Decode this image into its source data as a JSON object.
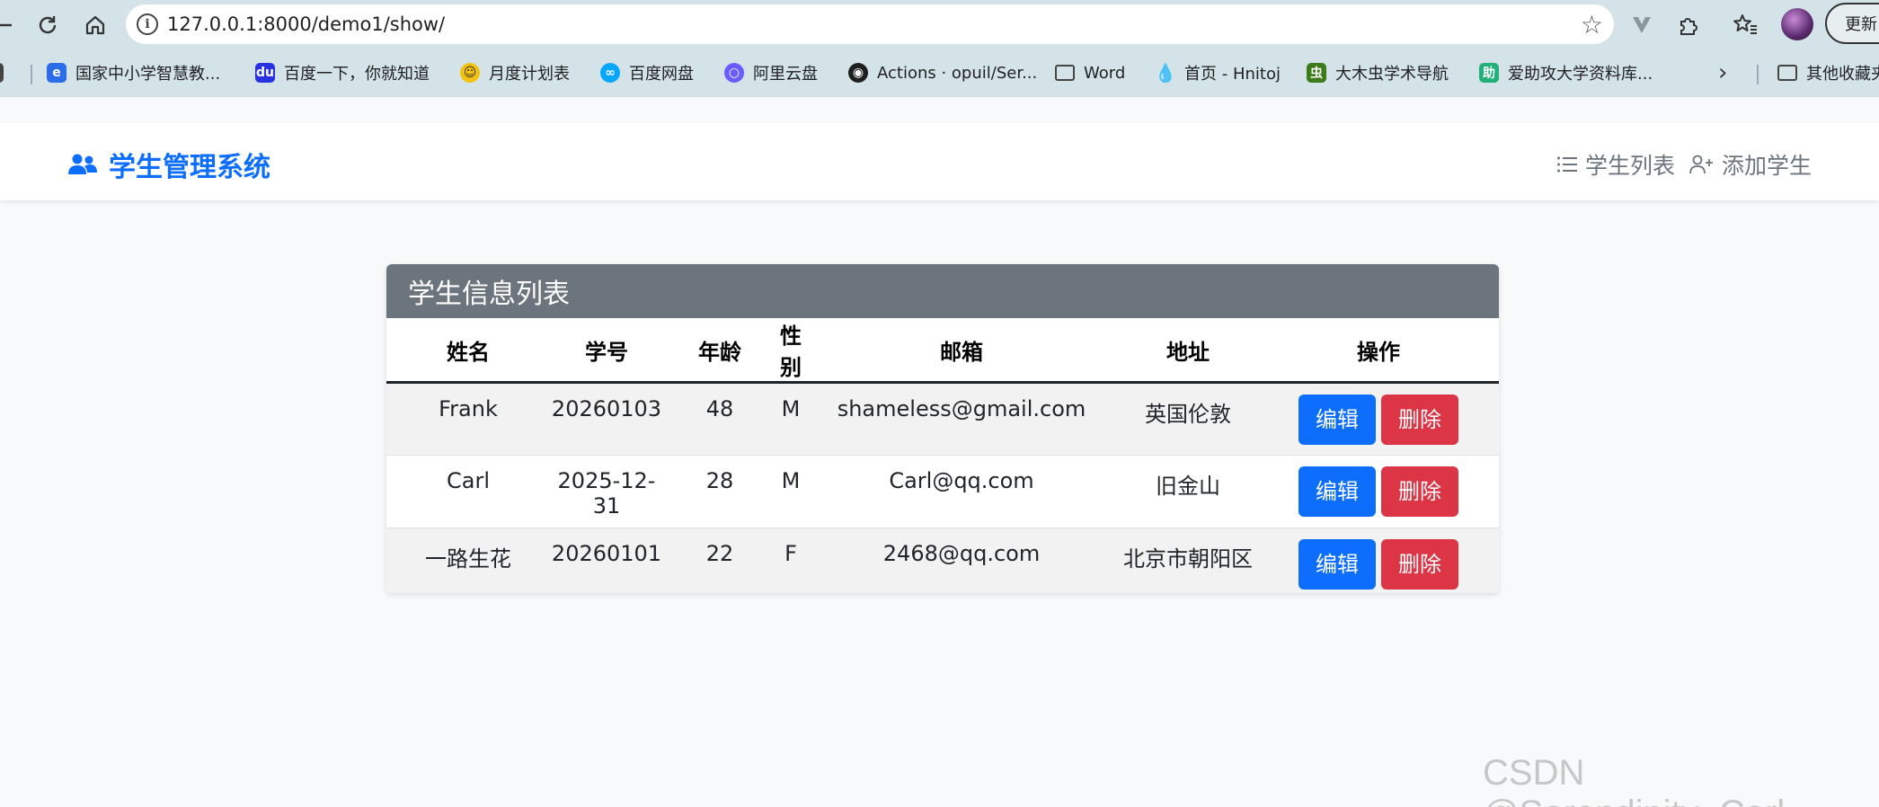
{
  "browser": {
    "url": "127.0.0.1:8000/demo1/show/",
    "update_label": "更新",
    "bookmarks": [
      {
        "label": "国家中小学智慧教...",
        "color": "#2b6de8"
      },
      {
        "label": "百度一下，你就知道",
        "color": "#2932e1"
      },
      {
        "label": "月度计划表",
        "color": "#f4c20d"
      },
      {
        "label": "百度网盘",
        "color": "#06a7ff"
      },
      {
        "label": "阿里云盘",
        "color": "#6a5cff"
      },
      {
        "label": "Actions · opuil/Ser...",
        "color": "#1f1f1f"
      },
      {
        "label": "Word",
        "color": ""
      },
      {
        "label": "首页 - Hnitoj",
        "color": "#4aa3df"
      },
      {
        "label": "大木虫学术导航",
        "color": "#3d7a1a"
      },
      {
        "label": "爱助攻大学资料库...",
        "color": "#21b07a"
      },
      {
        "label": "其他收藏夹",
        "color": ""
      }
    ]
  },
  "app": {
    "brand": "学生管理系统",
    "nav": {
      "list_label": "学生列表",
      "add_label": "添加学生"
    },
    "colors": {
      "primary": "#0d6efd",
      "danger": "#dc3545",
      "header_bg": "#6c757d"
    }
  },
  "table": {
    "title": "学生信息列表",
    "columns": [
      "姓名",
      "学号",
      "年龄",
      "性别",
      "邮箱",
      "地址",
      "操作"
    ],
    "rows": [
      {
        "name": "Frank",
        "id": "20260103",
        "age": "48",
        "gender": "M",
        "email": "shameless@gmail.com",
        "address": "英国伦敦"
      },
      {
        "name": "Carl",
        "id": "2025-12-31",
        "age": "28",
        "gender": "M",
        "email": "Carl@qq.com",
        "address": "旧金山"
      },
      {
        "name": "一路生花",
        "id": "20260101",
        "age": "22",
        "gender": "F",
        "email": "2468@qq.com",
        "address": "北京市朝阳区"
      }
    ],
    "edit_label": "编辑",
    "delete_label": "删除"
  },
  "watermark": "CSDN @Serendipity_Carl"
}
